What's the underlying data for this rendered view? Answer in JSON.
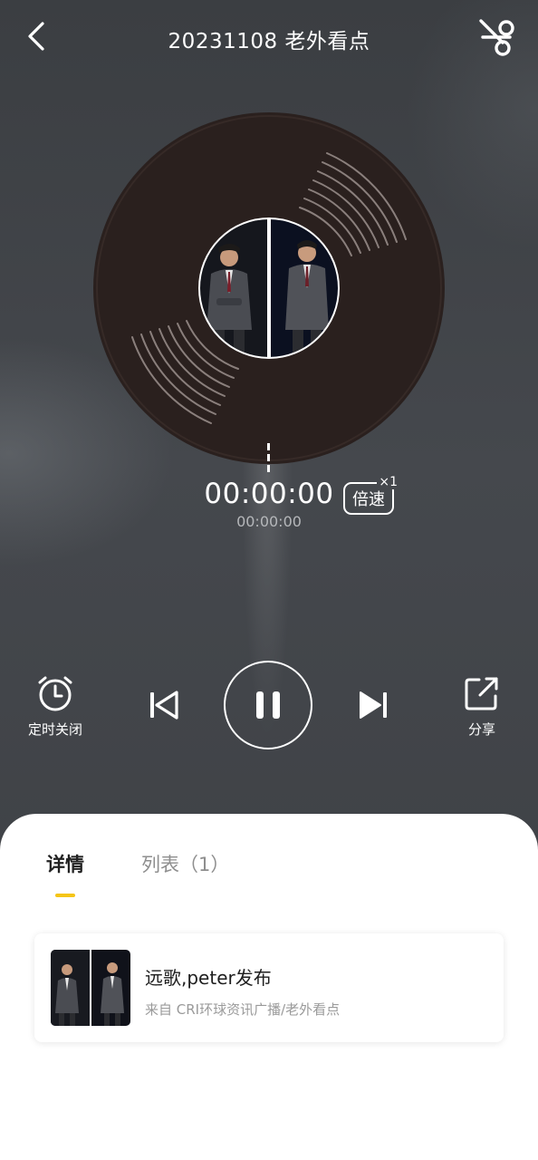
{
  "header": {
    "title": "20231108 老外看点",
    "back_icon": "chevron-left-icon",
    "clip_icon": "scissors-icon"
  },
  "player": {
    "current_time": "00:00:00",
    "total_time": "00:00:00",
    "speed_label": "倍速",
    "speed_multiplier": "×1"
  },
  "controls": {
    "timer_label": "定时关闭",
    "share_label": "分享",
    "timer_icon": "alarm-clock-icon",
    "share_icon": "share-icon",
    "prev_icon": "skip-previous-icon",
    "pause_icon": "pause-icon",
    "next_icon": "skip-next-icon"
  },
  "tabs": {
    "details": "详情",
    "list": "列表（1）",
    "active": "details"
  },
  "episode": {
    "title": "远歌,peter发布",
    "source": "来自 CRI环球资讯广播/老外看点"
  },
  "colors": {
    "accent": "#f5c518",
    "vinyl": "#2a201e",
    "background": "#3f4246",
    "sheet": "#ffffff"
  }
}
